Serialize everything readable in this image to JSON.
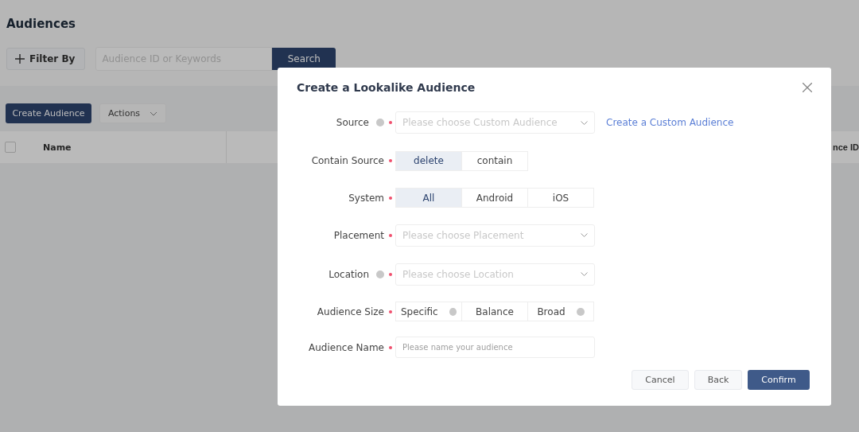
{
  "page": {
    "title": "Audiences",
    "filter_button": "Filter By",
    "search": {
      "placeholder": "Audience ID or Keywords"
    },
    "search_button": "Search",
    "create_button": "Create Audience",
    "actions_button": "Actions",
    "table": {
      "select_all": {
        "checked": false
      },
      "columns": [
        "Name",
        "nce ID"
      ]
    }
  },
  "dialog": {
    "title": "Create a Lookalike Audience",
    "fields": [
      {
        "kind": "select",
        "label": "Source",
        "help": true,
        "required": true,
        "placeholder": "Please choose Custom Audience",
        "link": "Create a Custom Audience"
      },
      {
        "kind": "segmented",
        "label": "Contain Source",
        "required": true,
        "options": [
          {
            "label": "delete",
            "selected": true
          },
          {
            "label": "contain",
            "selected": false
          }
        ]
      },
      {
        "kind": "segmented",
        "label": "System",
        "required": true,
        "options": [
          {
            "label": "All",
            "selected": true
          },
          {
            "label": "Android",
            "selected": false
          },
          {
            "label": "iOS",
            "selected": false
          }
        ]
      },
      {
        "kind": "select",
        "label": "Placement",
        "required": true,
        "placeholder": "Please choose Placement"
      },
      {
        "kind": "select",
        "label": "Location",
        "help": true,
        "required": true,
        "placeholder": "Please choose Location"
      },
      {
        "kind": "segmented",
        "label": "Audience Size",
        "required": true,
        "options": [
          {
            "label": "Specific",
            "selected": false,
            "help": true
          },
          {
            "label": "Balance",
            "selected": false
          },
          {
            "label": "Broad",
            "selected": false,
            "help": true
          }
        ]
      },
      {
        "kind": "input",
        "label": "Audience Name",
        "required": true,
        "placeholder": "Please name your audience"
      }
    ],
    "buttons": [
      {
        "label": "Cancel",
        "kind": "default"
      },
      {
        "label": "Back",
        "kind": "default"
      },
      {
        "label": "Confirm",
        "kind": "primary"
      }
    ]
  }
}
